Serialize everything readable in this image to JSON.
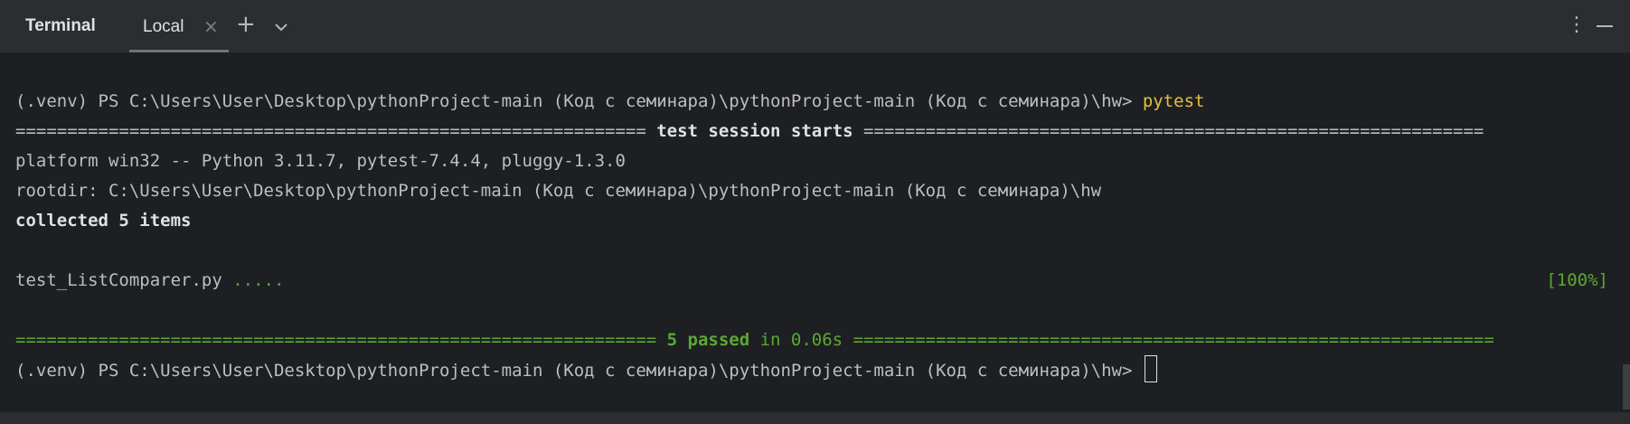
{
  "header": {
    "title": "Terminal",
    "tab_label": "Local",
    "tab_close_glyph": "×",
    "add_glyph": "+",
    "more_glyph": "⋮"
  },
  "terminal": {
    "prompt": "(.venv) PS C:\\Users\\User\\Desktop\\pythonProject-main (Код с семинара)\\pythonProject-main (Код с семинара)\\hw> ",
    "command": "pytest",
    "sep_start_left": "============================================================= ",
    "session_starts": "test session starts",
    "sep_start_right": " ============================================================",
    "platform": "platform win32 -- Python 3.11.7, pytest-7.4.4, pluggy-1.3.0",
    "rootdir": "rootdir: C:\\Users\\User\\Desktop\\pythonProject-main (Код с семинара)\\pythonProject-main (Код с семинара)\\hw",
    "collected": "collected 5 items",
    "test_file": "test_ListComparer.py ",
    "test_dots": ".....",
    "progress": "[100%]",
    "sep_end_left": "============================================================== ",
    "passed": "5 passed",
    "duration": " in 0.06s",
    "sep_end_right": " =============================================================="
  },
  "colors": {
    "background": "#1e1f22",
    "toolbar": "#2b2d30",
    "command": "#e2c13b",
    "success": "#5ba832"
  }
}
